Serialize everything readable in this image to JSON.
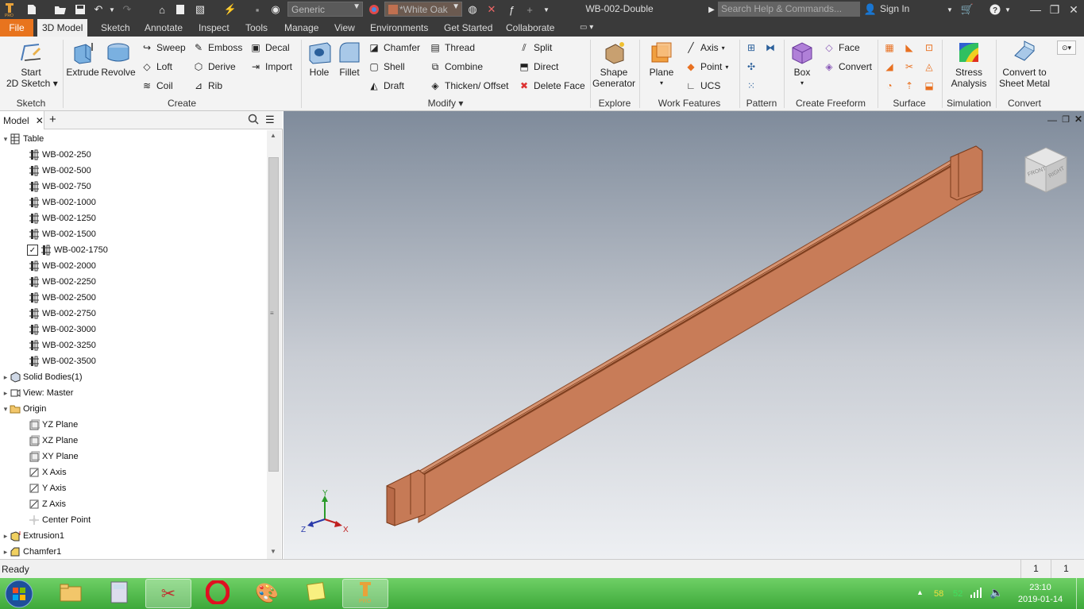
{
  "titlebar": {
    "document_title": "WB-002-Double",
    "appearance_combo": "Generic",
    "material_combo": "*White Oak",
    "search_placeholder": "Search Help & Commands...",
    "sign_in": "Sign In"
  },
  "tabs": [
    "File",
    "3D Model",
    "Sketch",
    "Annotate",
    "Inspect",
    "Tools",
    "Manage",
    "View",
    "Environments",
    "Get Started",
    "Collaborate"
  ],
  "ribbon": {
    "sketch": {
      "start_sketch_line1": "Start",
      "start_sketch_line2": "2D Sketch",
      "label": "Sketch"
    },
    "create": {
      "extrude": "Extrude",
      "revolve": "Revolve",
      "sweep": "Sweep",
      "loft": "Loft",
      "coil": "Coil",
      "emboss": "Emboss",
      "derive": "Derive",
      "rib": "Rib",
      "decal": "Decal",
      "import": "Import",
      "label": "Create"
    },
    "modify": {
      "hole": "Hole",
      "fillet": "Fillet",
      "chamfer": "Chamfer",
      "shell": "Shell",
      "draft": "Draft",
      "thread": "Thread",
      "combine": "Combine",
      "thicken": "Thicken/ Offset",
      "split": "Split",
      "direct": "Direct",
      "delete_face": "Delete Face",
      "label": "Modify"
    },
    "explore": {
      "shape_gen_line1": "Shape",
      "shape_gen_line2": "Generator",
      "label": "Explore"
    },
    "work_features": {
      "plane": "Plane",
      "axis": "Axis",
      "point": "Point",
      "ucs": "UCS",
      "label": "Work Features"
    },
    "pattern": {
      "label": "Pattern"
    },
    "freeform": {
      "box": "Box",
      "face": "Face",
      "convert": "Convert",
      "label": "Create Freeform"
    },
    "surface": {
      "label": "Surface"
    },
    "simulation": {
      "stress_line1": "Stress",
      "stress_line2": "Analysis",
      "label": "Simulation"
    },
    "convert": {
      "sheet_line1": "Convert to",
      "sheet_line2": "Sheet Metal",
      "label": "Convert"
    }
  },
  "browser": {
    "tab_label": "Model",
    "tree": {
      "table": "Table",
      "rows": [
        "WB-002-250",
        "WB-002-500",
        "WB-002-750",
        "WB-002-1000",
        "WB-002-1250",
        "WB-002-1500",
        "WB-002-1750",
        "WB-002-2000",
        "WB-002-2250",
        "WB-002-2500",
        "WB-002-2750",
        "WB-002-3000",
        "WB-002-3250",
        "WB-002-3500"
      ],
      "active_row": "WB-002-1750",
      "solid_bodies": "Solid Bodies(1)",
      "view": "View: Master",
      "origin": "Origin",
      "origin_items": [
        "YZ Plane",
        "XZ Plane",
        "XY Plane",
        "X Axis",
        "Y Axis",
        "Z Axis",
        "Center Point"
      ],
      "extrusion": "Extrusion1",
      "chamfer": "Chamfer1"
    }
  },
  "viewcube": {
    "front": "FRONT",
    "right": "RIGHT"
  },
  "triad": {
    "x": "X",
    "y": "Y",
    "z": "Z"
  },
  "status": {
    "text": "Ready",
    "count1": "1",
    "count2": "1"
  },
  "taskbar": {
    "time": "23:10",
    "date": "2019-01-14",
    "tray_num1": "58",
    "tray_num2": "52"
  },
  "colors": {
    "accent": "#e8741e",
    "wood": "#c8805e",
    "taskbar": "#3da93a"
  }
}
